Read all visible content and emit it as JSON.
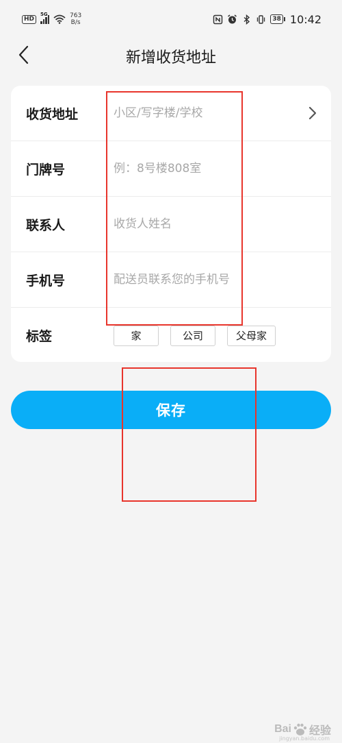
{
  "status_bar": {
    "hd_badge": "HD",
    "signal_label": "5G",
    "net_speed_value": "763",
    "net_speed_unit": "B/s",
    "battery": "38",
    "time": "10:42"
  },
  "nav": {
    "title": "新增收货地址"
  },
  "form": {
    "rows": [
      {
        "label": "收货地址",
        "placeholder": "小区/写字楼/学校",
        "value": ""
      },
      {
        "label": "门牌号",
        "placeholder": "例：8号楼808室",
        "value": ""
      },
      {
        "label": "联系人",
        "placeholder": "收货人姓名",
        "value": ""
      },
      {
        "label": "手机号",
        "placeholder": "配送员联系您的手机号",
        "value": ""
      },
      {
        "label": "标签"
      }
    ],
    "tags": [
      "家",
      "公司",
      "父母家"
    ]
  },
  "save_label": "保存",
  "watermark": {
    "brand": "Bai",
    "brand_suffix": "经验",
    "sub": "jingyan.baidu.com"
  },
  "colors": {
    "accent": "#0aaef7",
    "annotation": "#e8342b",
    "background": "#f4f4f4"
  },
  "icons": {
    "back": "chevron-left-icon",
    "address_arrow": "chevron-right-icon"
  }
}
